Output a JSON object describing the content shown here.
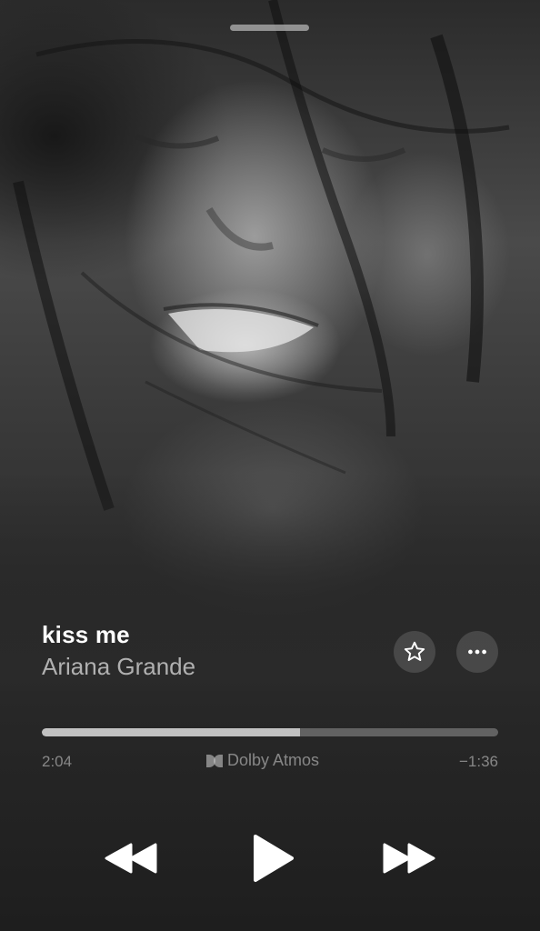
{
  "track": {
    "title": "kiss me",
    "artist": "Ariana Grande"
  },
  "progress": {
    "elapsed": "2:04",
    "remaining": "−1:36",
    "fraction": 0.565
  },
  "audio_format": {
    "label": "Dolby Atmos",
    "icon": "dolby-icon"
  },
  "actions": {
    "favorite_icon": "star-icon",
    "more_icon": "ellipsis-icon"
  },
  "controls": {
    "previous_icon": "rewind-icon",
    "play_icon": "play-icon",
    "next_icon": "fast-forward-icon"
  },
  "colors": {
    "background": "#222222",
    "text_primary": "#ffffff",
    "text_secondary": "#c8c8c8"
  }
}
